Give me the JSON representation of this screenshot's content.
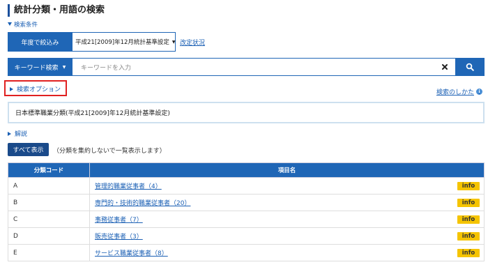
{
  "page_title": "統計分類・用語の検索",
  "conditions_toggle": "検索条件",
  "year": {
    "label": "年度で絞込み",
    "selected": "平成21[2009]年12月統計基準設定",
    "revision_link": "改定状況"
  },
  "search": {
    "mode_label": "キーワード検索",
    "placeholder": "キーワードを入力"
  },
  "options_link": "検索オプション",
  "howto_link": "検索のしかた",
  "classification_name": "日本標準職業分類(平成21[2009]年12月統計基準設定)",
  "kaisetsu_link": "解説",
  "show_all": {
    "button": "すべて表示",
    "note": "（分類を集約しないで一覧表示します）"
  },
  "table": {
    "headers": [
      "分類コード",
      "項目名"
    ],
    "info_label": "info",
    "rows": [
      {
        "code": "A",
        "name": "管理的職業従事者（4）"
      },
      {
        "code": "B",
        "name": "専門的・技術的職業従事者（20）"
      },
      {
        "code": "C",
        "name": "事務従事者（7）"
      },
      {
        "code": "D",
        "name": "販売従事者（3）"
      },
      {
        "code": "E",
        "name": "サービス職業従事者（8）"
      }
    ]
  },
  "colors": {
    "primary": "#1f66b6",
    "link": "#1a5fb4",
    "highlight_box": "#e02020",
    "info_badge": "#f5c400"
  }
}
